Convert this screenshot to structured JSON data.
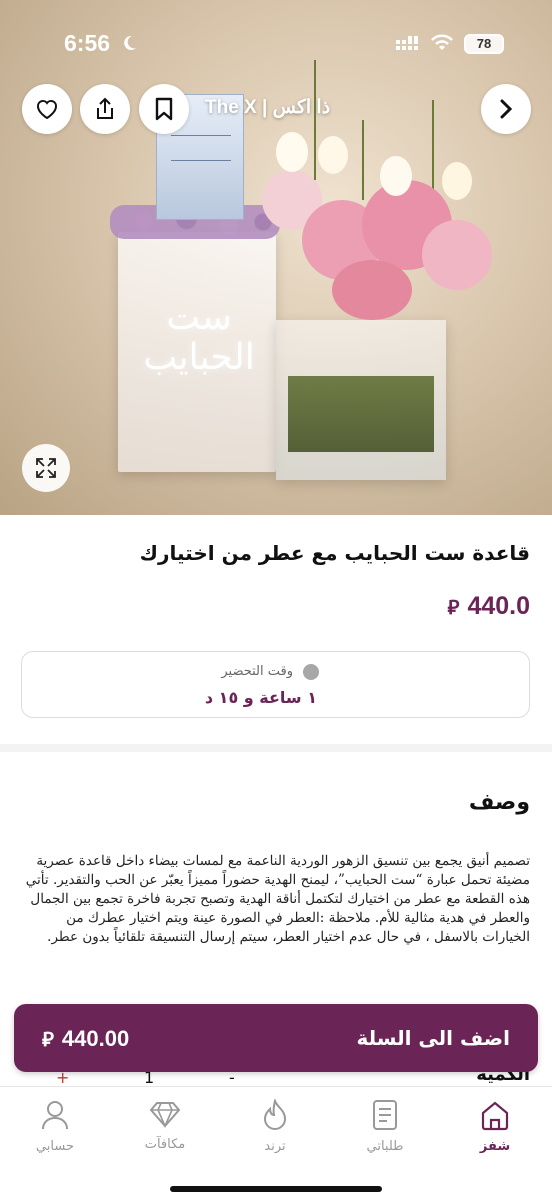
{
  "status_bar": {
    "time": "6:56",
    "battery": "78"
  },
  "header": {
    "store_name": "The X | ذا اكس",
    "back_icon": "chevron-right-icon",
    "bookmark_icon": "bookmark-icon",
    "share_icon": "share-icon",
    "favorite_icon": "heart-icon"
  },
  "hero_image": {
    "calligraphy_text": "ست الحبايب",
    "expand_icon": "expand-icon"
  },
  "product": {
    "title": "قاعدة ست الحبايب مع عطر من اختيارك",
    "price": "440.0",
    "currency_symbol": "⃁",
    "prep_time_label": "وقت التحضير",
    "prep_time_value": "١ ساعة و ١٥ د"
  },
  "description": {
    "title": "وصف",
    "text": "تصميم أنيق يجمع بين تنسيق الزهور الوردية الناعمة مع لمسات بيضاء داخل قاعدة عصرية مضيئة تحمل عبارة “ست الحبايب”، ليمنح الهدية حضوراً مميزاً يعبّر عن الحب والتقدير. تأتي هذه القطعة مع عطر من اختيارك لتكتمل أناقة الهدية وتصبح تجربة فاخرة تجمع بين الجمال والعطر في هدية مثالية للأم. ملاحظة :العطر في الصورة عينة ويتم اختيار عطرك من الخيارات بالاسفل ، في حال عدم اختيار العطر، سيتم إرسال التنسيقة تلقائياً بدون عطر."
  },
  "quantity": {
    "title": "الكمية",
    "value": "1",
    "minus": "-",
    "plus": "+"
  },
  "cart": {
    "label": "اضف الى السلة",
    "price": "440.00"
  },
  "tabs": [
    {
      "label": "شفز",
      "icon": "home-icon",
      "active": true
    },
    {
      "label": "طلباتي",
      "icon": "orders-icon",
      "active": false
    },
    {
      "label": "ترند",
      "icon": "flame-icon",
      "active": false
    },
    {
      "label": "مكافآت",
      "icon": "diamond-icon",
      "active": false
    },
    {
      "label": "حسابي",
      "icon": "user-icon",
      "active": false
    }
  ],
  "colors": {
    "accent": "#6b2456",
    "muted": "#999999"
  }
}
